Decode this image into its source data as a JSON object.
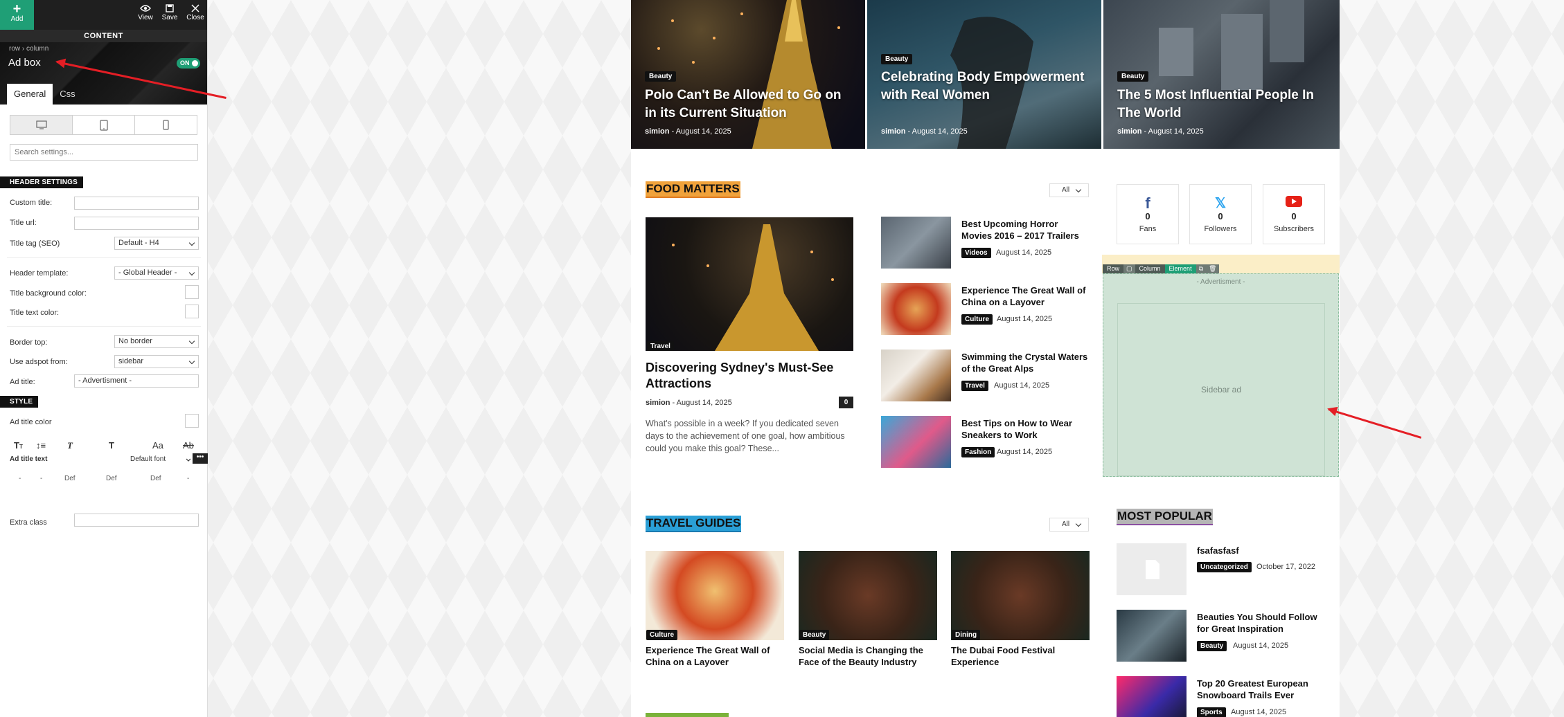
{
  "toolbar": {
    "add_label": "Add",
    "view_label": "View",
    "save_label": "Save",
    "close_label": "Close",
    "content_label": "CONTENT"
  },
  "element": {
    "crumb_row": "row",
    "crumb_sep": "›",
    "crumb_column": "column",
    "title": "Ad box",
    "toggle": "ON"
  },
  "panel_tabs": [
    "General",
    "Css"
  ],
  "search_placeholder": "Search settings...",
  "header_settings": {
    "section": "HEADER SETTINGS",
    "custom_title": "Custom title:",
    "title_url": "Title url:",
    "title_tag": "Title tag (SEO)",
    "title_tag_value": "Default - H4",
    "header_template": "Header template:",
    "header_template_value": "- Global Header -",
    "title_bg_color": "Title background color:",
    "title_text_color": "Title text color:",
    "border_top": "Border top:",
    "border_top_value": "No border",
    "use_adspot": "Use adspot from:",
    "use_adspot_value": "sidebar",
    "ad_title": "Ad title:",
    "ad_title_value": "- Advertisment -"
  },
  "style_settings": {
    "section": "STYLE",
    "ad_title_color": "Ad title color",
    "ad_title_text": "Ad title text",
    "font_value": "Default font",
    "typo_icons": [
      "TT",
      "T",
      "Aa",
      "Ab"
    ],
    "def_values": [
      "-",
      "-",
      "Def",
      "Def",
      "Def",
      "-"
    ],
    "extra_class": "Extra class"
  },
  "hero": [
    {
      "cat": "Beauty",
      "title": "Polo Can't Be Allowed to Go on in its Current Situation",
      "author": "simion",
      "date": "August 14, 2025"
    },
    {
      "cat": "Beauty",
      "title": "Celebrating Body Empowerment with Real Women",
      "author": "simion",
      "date": "August 14, 2025"
    },
    {
      "cat": "Beauty",
      "title": "The 5 Most Influential People In The World",
      "author": "simion",
      "date": "August 14, 2025"
    }
  ],
  "food": {
    "title": "FOOD MATTERS",
    "filter": "All",
    "main": {
      "cat": "Travel",
      "title": "Discovering Sydney's Must-See Attractions",
      "author": "simion",
      "date": "August 14, 2025",
      "comments": "0",
      "excerpt": "What's possible in a week? If you dedicated seven days to the achievement of one goal, how ambitious could you make this goal? These..."
    },
    "list": [
      {
        "title": "Best Upcoming Horror Movies 2016 – 2017 Trailers",
        "cat": "Videos",
        "date": "August 14, 2025"
      },
      {
        "title": "Experience The Great Wall of China on a Layover",
        "cat": "Culture",
        "date": "August 14, 2025"
      },
      {
        "title": "Swimming the Crystal Waters of the Great Alps",
        "cat": "Travel",
        "date": "August 14, 2025"
      },
      {
        "title": "Best Tips on How to Wear Sneakers to Work",
        "cat": "Fashion",
        "date": "August 14, 2025"
      }
    ]
  },
  "social": [
    {
      "count": "0",
      "label": "Fans"
    },
    {
      "count": "0",
      "label": "Followers"
    },
    {
      "count": "0",
      "label": "Subscribers"
    }
  ],
  "ad": {
    "crumbs": [
      "Row",
      "Column",
      "Element"
    ],
    "title": "- Advertisment -",
    "placeholder": "Sidebar ad"
  },
  "travel": {
    "title": "TRAVEL GUIDES",
    "filter": "All",
    "items": [
      {
        "cat": "Culture",
        "title": "Experience The Great Wall of China on a Layover"
      },
      {
        "cat": "Beauty",
        "title": "Social Media is Changing the Face of the Beauty Industry"
      },
      {
        "cat": "Dining",
        "title": "The Dubai Food Festival Experience"
      }
    ]
  },
  "popular": {
    "title": "MOST POPULAR",
    "items": [
      {
        "title": "fsafasfasf",
        "cat": "Uncategorized",
        "date": "October 17, 2022"
      },
      {
        "title": "Beauties You Should Follow for Great Inspiration",
        "cat": "Beauty",
        "date": "August 14, 2025"
      },
      {
        "title": "Top 20 Greatest European Snowboard Trails Ever",
        "cat": "Sports",
        "date": "August 14, 2025"
      }
    ]
  },
  "colors": {
    "accent": "#1f9f76",
    "food_title_bg": "#f0a23b",
    "travel_title_bg": "#2a9fd6",
    "popular_title_bg": "#b5b5b5",
    "ad_bg": "#cfe3d5",
    "ad_bar": "#fbeec7",
    "arrow": "#e41e25"
  }
}
